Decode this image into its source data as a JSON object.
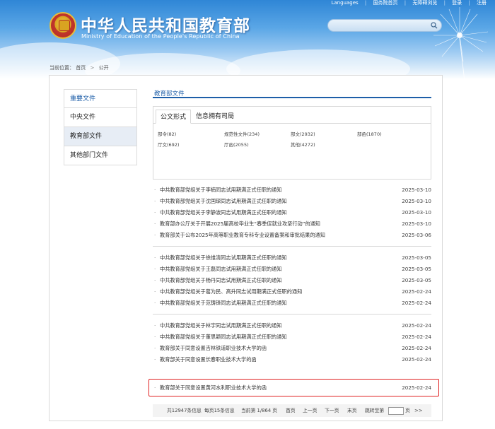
{
  "topbar": {
    "items": [
      "Languages",
      "国务院首页",
      "无障碍浏览",
      "登录",
      "注册"
    ]
  },
  "header": {
    "title_cn": "中华人民共和国教育部",
    "title_en": "Ministry of Education of the People's Republic of China"
  },
  "breadcrumb": {
    "label": "当前位置：",
    "home": "首页",
    "current": "公开"
  },
  "sidebar": {
    "items": [
      {
        "label": "重要文件"
      },
      {
        "label": "中央文件"
      },
      {
        "label": "教育部文件"
      },
      {
        "label": "其他部门文件"
      }
    ]
  },
  "section": {
    "title": "教育部文件"
  },
  "tabs": [
    {
      "label": "公文形式"
    },
    {
      "label": "信息拥有司局"
    }
  ],
  "categories": [
    {
      "label": "部令(82)"
    },
    {
      "label": "规范性文件(234)"
    },
    {
      "label": "部文(2932)"
    },
    {
      "label": "部函(1870)"
    },
    {
      "label": "厅文(692)"
    },
    {
      "label": "厅函(2055)"
    },
    {
      "label": "其他(4272)"
    }
  ],
  "list": [
    {
      "title": "中共教育部党组关于李楠同志试用期满正式任职的通知",
      "date": "2025-03-10"
    },
    {
      "title": "中共教育部党组关于沈国琛同志试用期满正式任职的通知",
      "date": "2025-03-10"
    },
    {
      "title": "中共教育部党组关于李静波同志试用期满正式任职的通知",
      "date": "2025-03-10"
    },
    {
      "title": "教育部办公厅关于开展2025届高校毕业生“春季促就业攻坚行动”的通知",
      "date": "2025-03-10"
    },
    {
      "title": "教育部关于公布2025年高等职业教育专科专业设置备案和审批结果的通知",
      "date": "2025-03-06"
    },
    {
      "title": "中共教育部党组关于徐维清同志试用期满正式任职的通知",
      "date": "2025-03-05"
    },
    {
      "title": "中共教育部党组关于王磊同志试用期满正式任职的通知",
      "date": "2025-03-05"
    },
    {
      "title": "中共教育部党组关于杨丹同志试用期满正式任职的通知",
      "date": "2025-03-05"
    },
    {
      "title": "中共教育部党组关于葛为民、高升同志试用期满正式任职的通知",
      "date": "2025-02-24"
    },
    {
      "title": "中共教育部党组关于范铸锋同志试用期满正式任职的通知",
      "date": "2025-02-24"
    },
    {
      "title": "中共教育部党组关于林宇同志试用期满正式任职的通知",
      "date": "2025-02-24"
    },
    {
      "title": "中共教育部党组关于董思颖同志试用期满正式任职的通知",
      "date": "2025-02-24"
    },
    {
      "title": "教育部关于同意设置吉林铁道职业技术大学的函",
      "date": "2025-02-24"
    },
    {
      "title": "教育部关于同意设置长春职业技术大学的函",
      "date": "2025-02-24"
    },
    {
      "title": "教育部关于同意设置黄河水利职业技术大学的函",
      "date": "2025-02-24"
    }
  ],
  "pager": {
    "total": "共12947条信息",
    "per_page": "每页15条信息",
    "current": "当前第 1/864 页",
    "first": "首页",
    "prev": "上一页",
    "next": "下一页",
    "last": "末页",
    "jump_label": "跳转至第",
    "page_unit": "页",
    "go": ">>"
  },
  "colors": {
    "accent": "#1d5ea8",
    "highlight": "#e02020"
  }
}
